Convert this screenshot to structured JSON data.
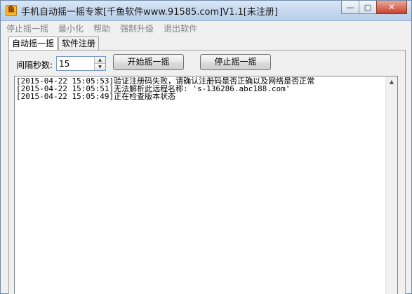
{
  "window": {
    "title": "手机自动摇一摇专家[千鱼软件www.91585.com]V1.1[未注册]",
    "icon_glyph": "鱼",
    "minimize_glyph": "—",
    "maximize_glyph": "□",
    "close_glyph": "✕"
  },
  "menu": {
    "items": [
      {
        "label": "停止摇一摇"
      },
      {
        "label": "最小化"
      },
      {
        "label": "帮助"
      },
      {
        "label": "强制升级"
      },
      {
        "label": "退出软件"
      }
    ],
    "color": "#808080"
  },
  "tabs": [
    {
      "label": "自动摇一摇",
      "active": true
    },
    {
      "label": "软件注册",
      "active": false
    }
  ],
  "controls": {
    "interval_label": "间隔秒数:",
    "interval_value": "15",
    "start_button": "开始摇一摇",
    "stop_button": "停止摇一摇"
  },
  "log": {
    "lines": [
      "[2015-04-22 15:05:53]验证注册码失败，请确认注册码是否正确以及网络是否正常",
      "[2015-04-22 15:05:51]无法解析此远程名称: 's-136286.abc188.com'",
      "[2015-04-22 15:05:49]正在检查版本状态"
    ]
  },
  "icons": {
    "app": "app-icon",
    "scroll_up": "scroll-up-icon"
  }
}
